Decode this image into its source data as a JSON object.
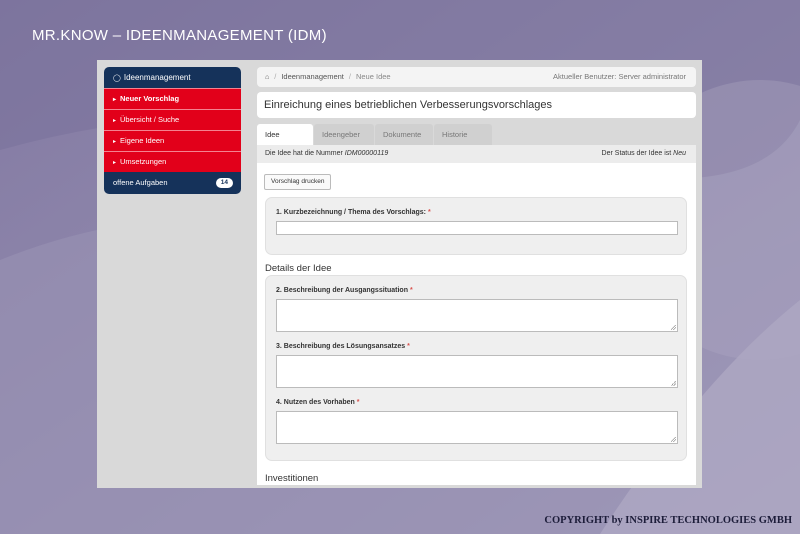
{
  "slide": {
    "title": "MR.KNOW – IDEENMANAGEMENT (IDM)",
    "copyright": "COPYRIGHT by INSPIRE TECHNOLOGIES GMBH"
  },
  "sidebar": {
    "header_label": "Ideenmanagement",
    "items": [
      {
        "label": "Neuer Vorschlag"
      },
      {
        "label": "Übersicht / Suche"
      },
      {
        "label": "Eigene Ideen"
      },
      {
        "label": "Umsetzungen"
      }
    ],
    "footer_label": "offene Aufgaben",
    "footer_badge": "14"
  },
  "breadcrumb": {
    "section": "Ideenmanagement",
    "current": "Neue Idee",
    "user_text": "Aktueller Benutzer: Server administrator"
  },
  "page_title": "Einreichung eines betrieblichen Verbesserungsvorschlages",
  "tabs": [
    "Idee",
    "Ideengeber",
    "Dokumente",
    "Historie"
  ],
  "info": {
    "number_prefix": "Die Idee hat die Nummer",
    "number": "IDM00000119",
    "status_prefix": "Der Status der Idee ist",
    "status": "Neu"
  },
  "print_button": "Vorschlag drucken",
  "fields": {
    "title_label": "1. Kurzbezeichnung / Thema des Vorschlags:",
    "section_details": "Details der Idee",
    "situation_label": "2. Beschreibung der Ausgangssituation",
    "solution_label": "3. Beschreibung des Lösungsansatzes",
    "benefit_label": "4. Nutzen des Vorhaben",
    "section_investments": "Investitionen",
    "required_marker": "*"
  },
  "colors": {
    "sidebar_navy": "#15325a",
    "sidebar_red": "#e2001a",
    "required": "#d9534f"
  }
}
